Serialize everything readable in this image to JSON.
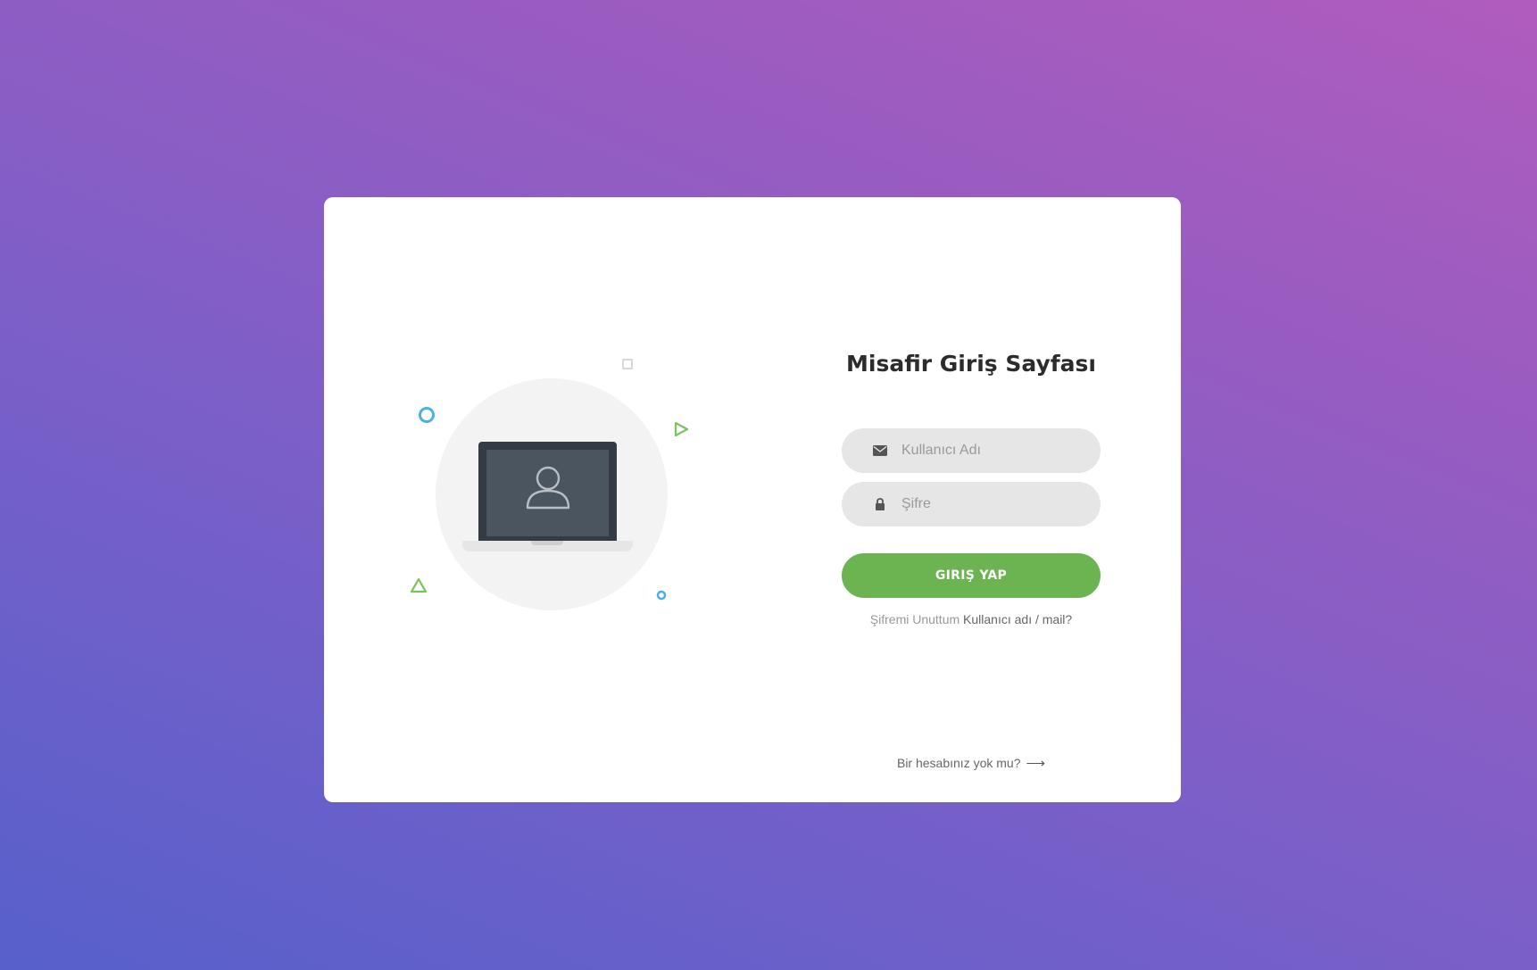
{
  "page": {
    "background_gradient": [
      "#5760cb",
      "#7b5fc8",
      "#9a5cc0",
      "#b05cbe"
    ],
    "card_color": "#ffffff"
  },
  "illustration": {
    "icons": [
      "laptop-icon",
      "user-icon"
    ],
    "decorations": [
      "blue-ring",
      "outline-square",
      "green-triangle-play",
      "green-triangle-outline",
      "blue-dot-ring"
    ],
    "accent_blue": "#46b3e0",
    "accent_green": "#7ac35a"
  },
  "form": {
    "title": "Misafir Giriş Sayfası",
    "username": {
      "placeholder": "Kullanıcı Adı",
      "value": "",
      "icon": "envelope-icon"
    },
    "password": {
      "placeholder": "Şifre",
      "value": "",
      "icon": "lock-icon"
    },
    "login_label": "GIRIŞ YAP",
    "login_color": "#6cb352",
    "forgot_prefix": "Şifremi Unuttum",
    "forgot_link": "Kullanıcı adı / mail?",
    "signup_label": "Bir hesabınız yok mu?",
    "signup_icon": "arrow-right-icon"
  }
}
